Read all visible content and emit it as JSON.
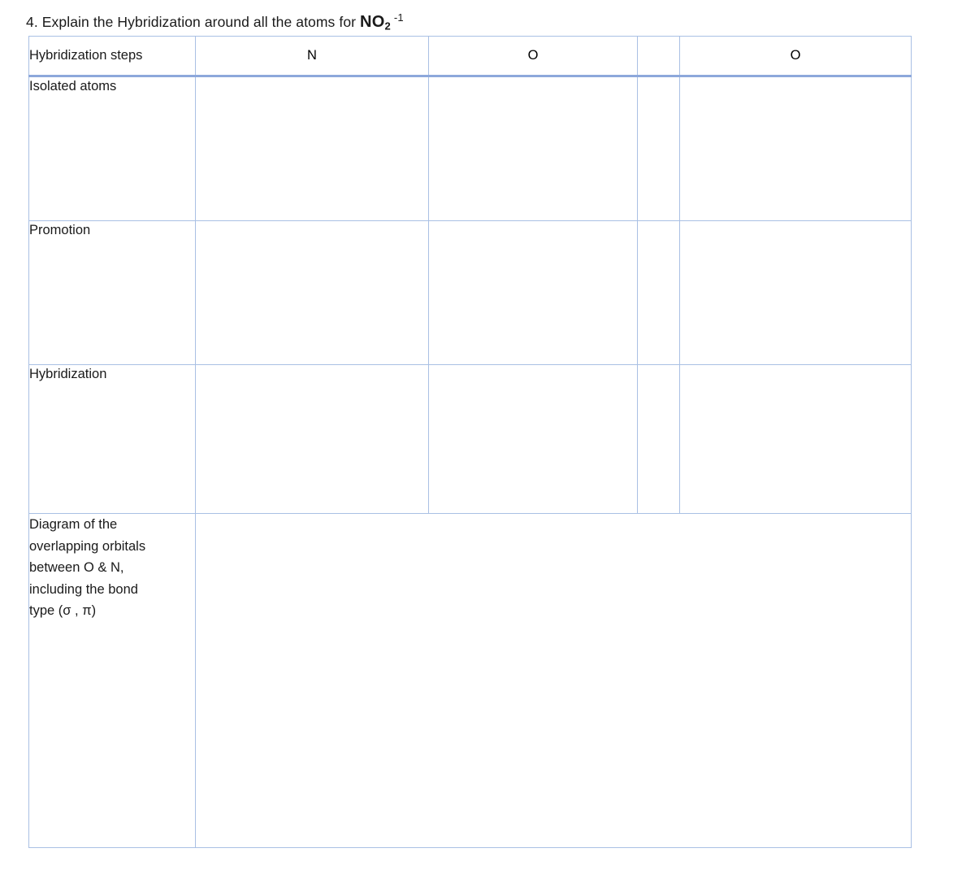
{
  "question": {
    "prefix": "4. Explain the Hybridization around all the atoms for ",
    "formula_main": "NO",
    "formula_sub": "2",
    "formula_charge": "-1",
    "full_text": "4. Explain the Hybridization around all the atoms for NO2 -1"
  },
  "table": {
    "header": {
      "label": "Hybridization steps",
      "atom_1": "N",
      "atom_spacer": "",
      "atom_2": "O",
      "atom_3": "O"
    },
    "rows": [
      {
        "label": "Isolated atoms",
        "n": "",
        "o1": "",
        "gap": "",
        "o2": ""
      },
      {
        "label": "Promotion",
        "n": "",
        "o1": "",
        "gap": "",
        "o2": ""
      },
      {
        "label": "Hybridization",
        "n": "",
        "o1": "",
        "gap": "",
        "o2": ""
      }
    ],
    "diagram_row": {
      "label_lines": [
        "Diagram of the",
        "overlapping orbitals",
        "between O & N,",
        "including the bond",
        "type (σ , π)"
      ],
      "label": "Diagram of the overlapping orbitals between O & N, including the bond type (σ , π)",
      "answer": ""
    }
  },
  "colors": {
    "border": "#a9c0e4",
    "header_rule": "#8da8db",
    "text": "#1a1a1a",
    "background": "#ffffff"
  }
}
